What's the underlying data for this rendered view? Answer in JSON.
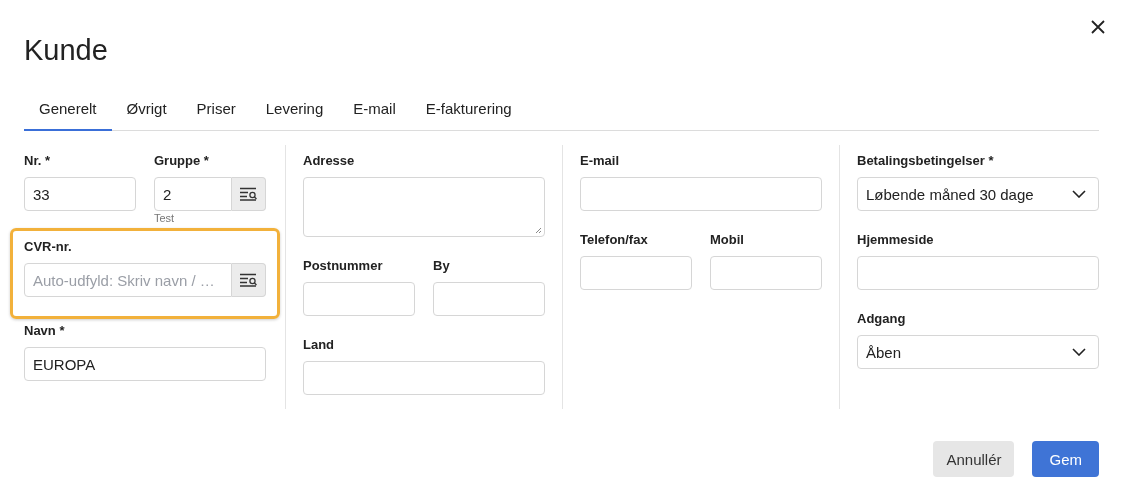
{
  "title": "Kunde",
  "tabs": [
    {
      "label": "Generelt",
      "selected": true
    },
    {
      "label": "Øvrigt",
      "selected": false
    },
    {
      "label": "Priser",
      "selected": false
    },
    {
      "label": "Levering",
      "selected": false
    },
    {
      "label": "E-mail",
      "selected": false
    },
    {
      "label": "E-fakturering",
      "selected": false
    }
  ],
  "columns": [
    [
      [
        {
          "kind": "text",
          "label": "Nr. *",
          "value": "33"
        },
        {
          "kind": "lookup",
          "label": "Gruppe *",
          "value": "2",
          "hint": "Test"
        }
      ],
      [
        {
          "kind": "lookup",
          "label": "CVR-nr.",
          "placeholder": "Auto-udfyld: Skriv navn / …",
          "highlighted": true
        }
      ],
      [
        {
          "kind": "text",
          "label": "Navn *",
          "value": "EUROPA"
        }
      ]
    ],
    [
      [
        {
          "kind": "textarea",
          "label": "Adresse"
        }
      ],
      [
        {
          "kind": "text",
          "label": "Postnummer"
        },
        {
          "kind": "text",
          "label": "By"
        }
      ],
      [
        {
          "kind": "text",
          "label": "Land"
        }
      ]
    ],
    [
      [
        {
          "kind": "text",
          "label": "E-mail"
        }
      ],
      [
        {
          "kind": "text",
          "label": "Telefon/fax"
        },
        {
          "kind": "text",
          "label": "Mobil"
        }
      ]
    ],
    [
      [
        {
          "kind": "select",
          "label": "Betalingsbetingelser *",
          "value": "Løbende måned 30 dage"
        }
      ],
      [
        {
          "kind": "text",
          "label": "Hjemmeside"
        }
      ],
      [
        {
          "kind": "select",
          "label": "Adgang",
          "value": "Åben"
        }
      ]
    ]
  ],
  "buttons": [
    {
      "label": "Annullér",
      "kind": "secondary"
    },
    {
      "label": "Gem",
      "kind": "primary"
    }
  ]
}
